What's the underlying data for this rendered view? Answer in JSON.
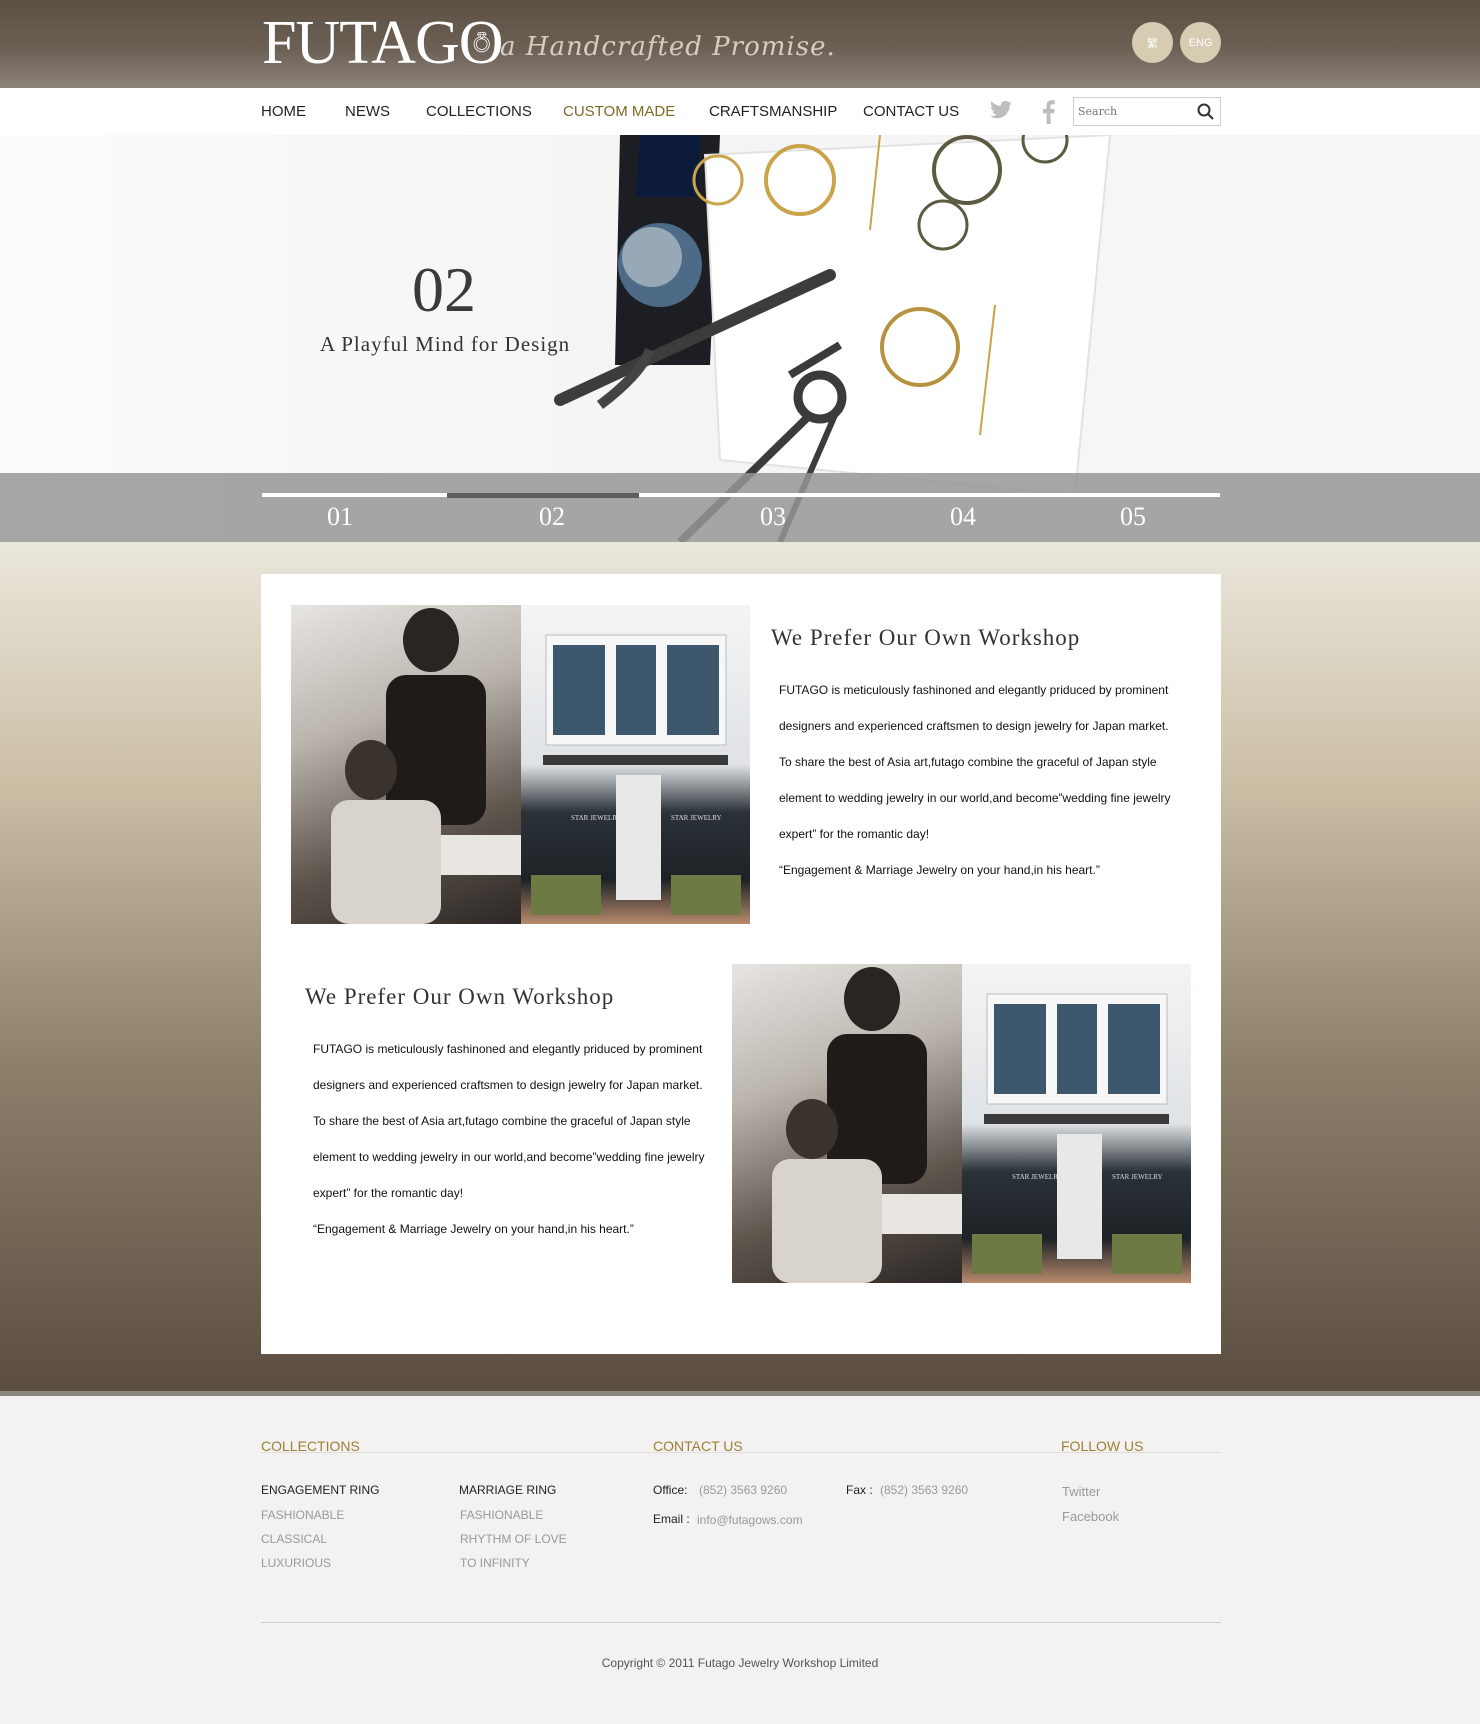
{
  "header": {
    "logo": "FUTAGO",
    "tagline": "a Handcrafted Promise.",
    "lang_zh": "繁",
    "lang_en": "ENG"
  },
  "nav": {
    "items": [
      "HOME",
      "NEWS",
      "COLLECTIONS",
      "CUSTOM MADE",
      "CRAFTSMANSHIP",
      "CONTACT US"
    ],
    "active": "CUSTOM MADE",
    "search_placeholder": "Search"
  },
  "hero": {
    "number": "02",
    "title": "A Playful Mind for Design",
    "slides": [
      "01",
      "02",
      "03",
      "04",
      "05"
    ],
    "active_slide": "02"
  },
  "sections": [
    {
      "title": "We Prefer Our Own Workshop",
      "lines": [
        "FUTAGO is meticulously fashinoned and elegantly priduced by prominent",
        "designers and experienced craftsmen to design jewelry for Japan market.",
        "To share the best of Asia art,futago combine the graceful of Japan style",
        "element to wedding jewelry in our world,and become”wedding fine jewelry",
        "expert” for the romantic day!",
        "“Engagement & Marriage Jewelry on your hand,in his heart.”"
      ]
    },
    {
      "title": "We Prefer Our Own Workshop",
      "lines": [
        "FUTAGO is meticulously fashinoned and elegantly priduced by prominent",
        "designers and experienced craftsmen to design jewelry for Japan market.",
        "To share the best of Asia art,futago combine the graceful of Japan style",
        "element to wedding jewelry in our world,and become”wedding fine jewelry",
        "expert” for the romantic day!",
        "“Engagement & Marriage Jewelry on your hand,in his heart.”"
      ]
    }
  ],
  "footer": {
    "collections": {
      "heading": "COLLECTIONS",
      "groups": [
        {
          "title": "ENGAGEMENT RING",
          "links": [
            "FASHIONABLE",
            "CLASSICAL",
            "LUXURIOUS"
          ]
        },
        {
          "title": "MARRIAGE RING",
          "links": [
            "FASHIONABLE",
            "RHYTHM OF LOVE",
            "TO INFINITY"
          ]
        }
      ]
    },
    "contact": {
      "heading": "CONTACT US",
      "office_label": "Office:",
      "office": "(852) 3563 9260",
      "fax_label": "Fax :",
      "fax": "(852) 3563 9260",
      "email_label": "Email :",
      "email": "info@futagows.com"
    },
    "follow": {
      "heading": "FOLLOW US",
      "links": [
        "Twitter",
        "Facebook"
      ]
    },
    "copyright": "Copyright © 2011 Futago Jewelry Workshop Limited"
  },
  "colors": {
    "accent_gold": "#9c8039",
    "nav_active": "#7e6a26",
    "header_brown": "#5c4f43",
    "lang_button": "#d6ccb2"
  },
  "icons": [
    "twitter-icon",
    "facebook-icon",
    "search-icon",
    "ring-icon"
  ]
}
